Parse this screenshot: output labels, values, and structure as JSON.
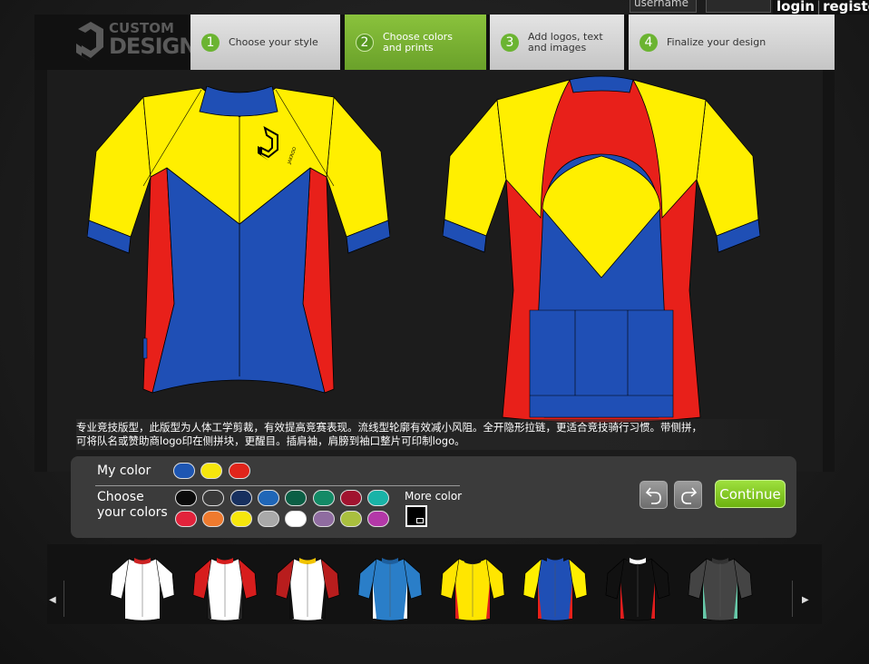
{
  "auth": {
    "username_placeholder": "username",
    "login_label": "login",
    "separator": "|",
    "register_label": "register"
  },
  "logo": {
    "line1": "CUSTOM",
    "line2": "DESIGN"
  },
  "steps": [
    {
      "num": "1",
      "label_line1": "Choose your style",
      "label_line2": "",
      "active": false
    },
    {
      "num": "2",
      "label_line1": "Choose colors",
      "label_line2": "and prints",
      "active": true
    },
    {
      "num": "3",
      "label_line1": "Add logos, text",
      "label_line2": "and images",
      "active": false
    },
    {
      "num": "4",
      "label_line1": "Finalize your design",
      "label_line2": "",
      "active": false
    }
  ],
  "jersey": {
    "colors": {
      "yellow": "#ffef00",
      "blue": "#1f4fb5",
      "red": "#e8201a"
    },
    "chest_logo_text": "JAKROO"
  },
  "description": {
    "line1": "专业竞技版型，此版型为人体工学剪裁，有效提高竞赛表现。流线型轮廓有效减小风阻。全开隐形拉链，更适合竞技骑行习惯。带侧拼，",
    "line2": "可将队名或赞助商logo印在侧拼块，更醒目。插肩袖，肩膀到袖口整片可印制logo。"
  },
  "color_panel": {
    "my_color_label": "My color",
    "my_colors": [
      "#1e56b2",
      "#f6e60c",
      "#e1251b"
    ],
    "choose_label_line1": "Choose",
    "choose_label_line2": "your colors",
    "palette_row1": [
      "#0b0b0b",
      "#3a3a3a",
      "#17305f",
      "#1f66b7",
      "#0b5f45",
      "#138a66",
      "#a1132f",
      "#19b3a7"
    ],
    "palette_row2": [
      "#e2223b",
      "#ee7a2e",
      "#f6e60c",
      "#a9a9a9",
      "#ffffff",
      "#8f6ca0",
      "#a9bf3e",
      "#b338a8"
    ],
    "more_color_label": "More color",
    "continue_label": "Continue"
  },
  "thumbnails": [
    {
      "name": "white"
    },
    {
      "name": "red-white"
    },
    {
      "name": "red-white-black"
    },
    {
      "name": "blue"
    },
    {
      "name": "yellow-red-stripe"
    },
    {
      "name": "yellow-blue-red"
    },
    {
      "name": "black-red"
    },
    {
      "name": "gray-teal"
    }
  ]
}
